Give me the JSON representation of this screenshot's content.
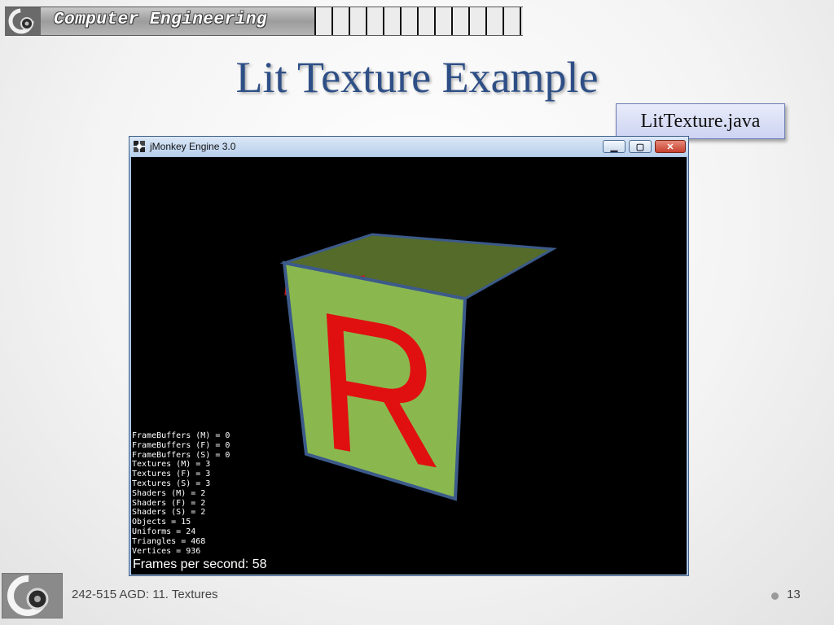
{
  "header": {
    "banner_text": "Computer Engineering"
  },
  "slide": {
    "title": "Lit Texture Example",
    "file_label": "LitTexture.java"
  },
  "window": {
    "title": "jMonkey Engine 3.0",
    "minimize_icon": "minimize-icon",
    "maximize_icon": "maximize-icon",
    "close_icon": "close-icon",
    "close_glyph": "✕",
    "minimize_glyph": "▁",
    "maximize_glyph": "▢"
  },
  "scene": {
    "cube_letter": "R",
    "colors": {
      "face_green": "#8ab84f",
      "top_green": "#556b2a",
      "letter_red": "#e01010",
      "edge_blue": "#3c5a8a"
    },
    "stats": [
      "FrameBuffers (M) = 0",
      "FrameBuffers (F) = 0",
      "FrameBuffers (S) = 0",
      "Textures (M) = 3",
      "Textures (F) = 3",
      "Textures (S) = 3",
      "Shaders (M) = 2",
      "Shaders (F) = 2",
      "Shaders (S) = 2",
      "Objects = 15",
      "Uniforms = 24",
      "Triangles = 468",
      "Vertices = 936"
    ],
    "fps_text": "Frames per second: 58"
  },
  "footer": {
    "course_text": "242-515 AGD: 11. Textures",
    "page_number": "13"
  }
}
